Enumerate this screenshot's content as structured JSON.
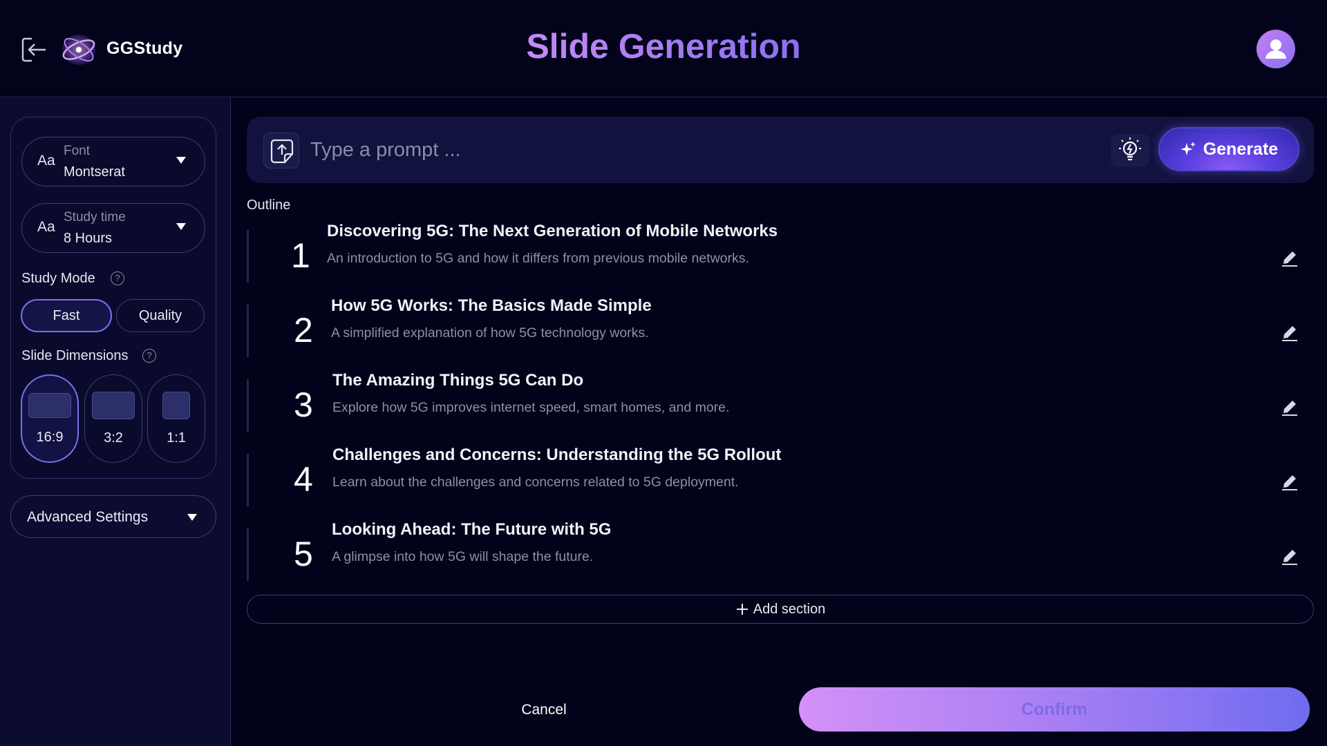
{
  "header": {
    "brand": "GGStudy",
    "title": "Slide Generation"
  },
  "sidebar": {
    "font": {
      "icon_text": "Aa",
      "label": "Font",
      "value": "Montserat"
    },
    "study_time": {
      "icon_text": "Aa",
      "label": "Study time",
      "value": "8 Hours"
    },
    "study_mode": {
      "label": "Study Mode",
      "help": "?",
      "options": [
        "Fast",
        "Quality"
      ],
      "selected": "Fast"
    },
    "slide_dimensions": {
      "label": "Slide Dimensions",
      "help": "?",
      "options": [
        "16:9",
        "3:2",
        "1:1"
      ],
      "selected": "16:9"
    },
    "advanced": {
      "label": "Advanced Settings"
    }
  },
  "prompt": {
    "placeholder": "Type a prompt ...",
    "value": "",
    "generate_label": "Generate"
  },
  "outline": {
    "label": "Outline",
    "items": [
      {
        "number": "1",
        "title": "Discovering 5G: The Next Generation of Mobile Networks",
        "description": "An introduction to 5G and how it differs from previous mobile networks."
      },
      {
        "number": "2",
        "title": "How 5G Works: The Basics Made Simple",
        "description": "A simplified explanation of how 5G technology works."
      },
      {
        "number": "3",
        "title": "The Amazing Things 5G Can Do",
        "description": "Explore how 5G improves internet speed, smart homes, and more."
      },
      {
        "number": "4",
        "title": "Challenges and Concerns: Understanding the 5G Rollout",
        "description": "Learn about the challenges and concerns related to 5G deployment."
      },
      {
        "number": "5",
        "title": "Looking Ahead: The Future with 5G",
        "description": "A glimpse into how 5G will shape the future."
      }
    ],
    "add_section_label": "Add section"
  },
  "footer": {
    "cancel_label": "Cancel",
    "confirm_label": "Confirm"
  },
  "colors": {
    "background": "#02021a",
    "sidebar": "#0c0c31",
    "accent": "#7c6ff0",
    "title_gradient_start": "#c58af4",
    "title_gradient_end": "#8a70ee"
  },
  "icons": {
    "back": "logout-arrow-icon",
    "logo": "orbit-logo-icon",
    "avatar": "user-avatar-icon",
    "upload": "upload-file-icon",
    "bulb": "lightbulb-icon",
    "generate": "sparkle-icon",
    "edit": "pencil-icon",
    "add": "plus-icon",
    "caret": "caret-down-icon",
    "help": "question-circle-icon"
  }
}
